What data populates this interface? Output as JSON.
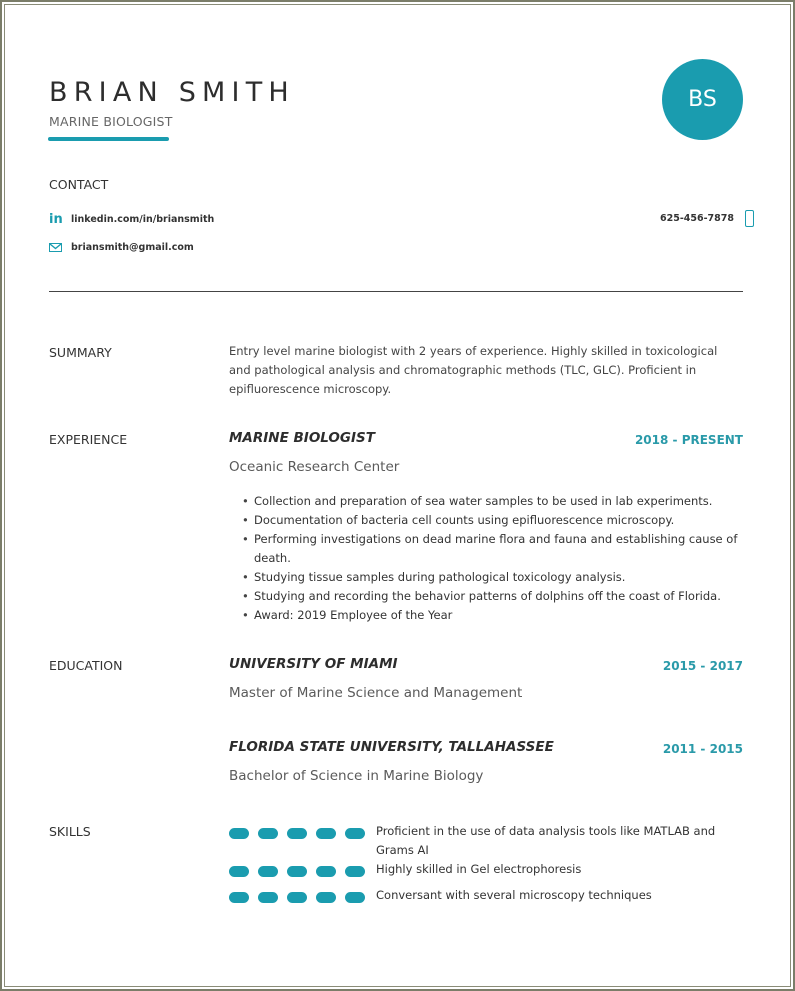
{
  "header": {
    "name": "BRIAN SMITH",
    "title": "MARINE BIOLOGIST",
    "initials": "BS",
    "accent_color": "#1a9caf"
  },
  "contact": {
    "heading": "CONTACT",
    "linkedin": "linkedin.com/in/briansmith",
    "email": "briansmith@gmail.com",
    "phone": "625-456-7878",
    "icons": {
      "linkedin": "linkedin-icon",
      "email": "envelope-icon",
      "phone": "mobile-phone-icon"
    }
  },
  "summary": {
    "label": "SUMMARY",
    "text": "Entry level marine biologist with 2 years of experience. Highly skilled in toxicological and pathological analysis and chromatographic methods (TLC, GLC). Proficient in epifluorescence microscopy."
  },
  "experience": {
    "label": "EXPERIENCE",
    "jobs": [
      {
        "title": "MARINE BIOLOGIST",
        "dates": "2018 - PRESENT",
        "organization": "Oceanic Research Center",
        "bullets": [
          "Collection and preparation of sea water samples to be used in lab experiments.",
          "Documentation of bacteria cell counts using epifluorescence microscopy.",
          "Performing investigations on dead marine flora and fauna and establishing cause of death.",
          "Studying tissue samples during pathological toxicology analysis.",
          "Studying and recording the behavior patterns of dolphins off the coast of Florida.",
          "Award: 2019 Employee of the Year"
        ]
      }
    ]
  },
  "education": {
    "label": "EDUCATION",
    "schools": [
      {
        "name": "UNIVERSITY OF MIAMI",
        "dates": "2015 - 2017",
        "degree": "Master of Marine Science and Management"
      },
      {
        "name": "FLORIDA STATE UNIVERSITY, TALLAHASSEE",
        "dates": "2011 - 2015",
        "degree": "Bachelor of Science in Marine Biology"
      }
    ]
  },
  "skills": {
    "label": "SKILLS",
    "items": [
      {
        "text": "Proficient in the use of data analysis tools like MATLAB and Grams AI",
        "level": 5,
        "max": 5
      },
      {
        "text": "Highly skilled in Gel electrophoresis",
        "level": 5,
        "max": 5
      },
      {
        "text": "Conversant with several microscopy techniques",
        "level": 5,
        "max": 5
      }
    ]
  }
}
